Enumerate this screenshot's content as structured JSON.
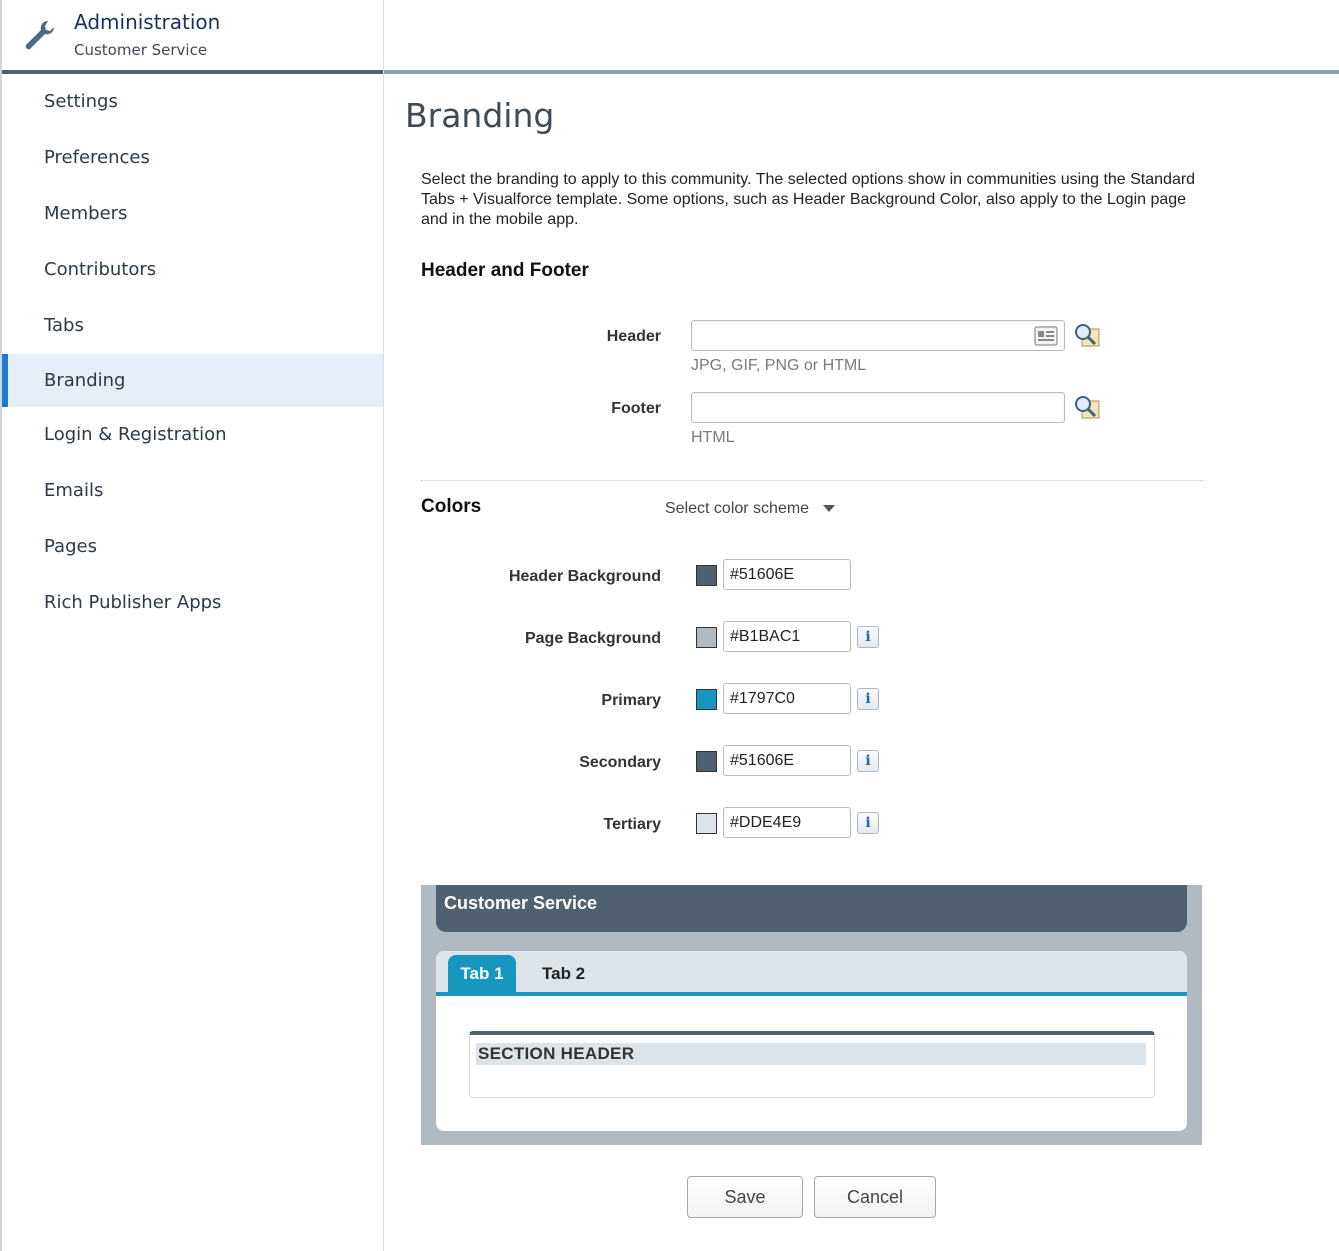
{
  "sidebar": {
    "title": "Administration",
    "subtitle": "Customer Service",
    "items": [
      {
        "label": "Settings"
      },
      {
        "label": "Preferences"
      },
      {
        "label": "Members"
      },
      {
        "label": "Contributors"
      },
      {
        "label": "Tabs"
      },
      {
        "label": "Branding",
        "active": true
      },
      {
        "label": "Login & Registration"
      },
      {
        "label": "Emails"
      },
      {
        "label": "Pages"
      },
      {
        "label": "Rich Publisher Apps"
      }
    ]
  },
  "main": {
    "title": "Branding",
    "description": "Select the branding to apply to this community. The selected options show in communities using the Standard Tabs + Visualforce template. Some options, such as Header Background Color, also apply to the Login page and in the mobile app.",
    "header_footer": {
      "section_title": "Header and Footer",
      "header_label": "Header",
      "header_value": "",
      "header_hint": "JPG, GIF, PNG or HTML",
      "footer_label": "Footer",
      "footer_value": "",
      "footer_hint": "HTML"
    },
    "colors": {
      "section_title": "Colors",
      "scheme_select": "Select color scheme",
      "fields": [
        {
          "label": "Header Background",
          "value": "#51606E"
        },
        {
          "label": "Page Background",
          "value": "#B1BAC1"
        },
        {
          "label": "Primary",
          "value": "#1797C0"
        },
        {
          "label": "Secondary",
          "value": "#51606E"
        },
        {
          "label": "Tertiary",
          "value": "#DDE4E9"
        }
      ]
    },
    "preview": {
      "header_title": "Customer Service",
      "tab1": "Tab 1",
      "tab2": "Tab 2",
      "section_header": "SECTION HEADER"
    },
    "buttons": {
      "save": "Save",
      "cancel": "Cancel"
    }
  },
  "icons": {
    "wrench": "wrench-icon",
    "lookup": "magnifier-lookup-icon",
    "image_picker": "image-picker-icon",
    "info": "info-icon"
  }
}
